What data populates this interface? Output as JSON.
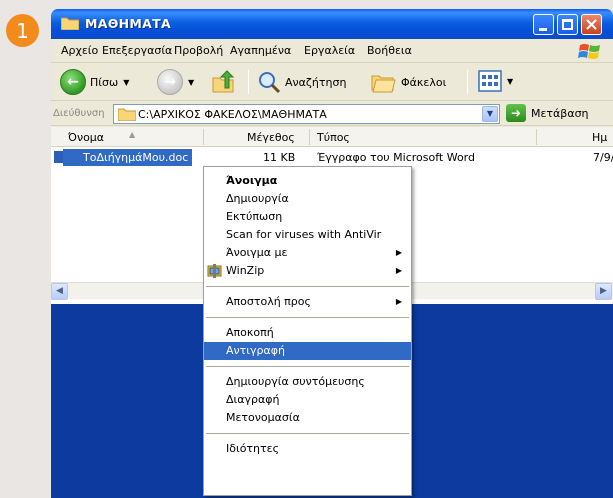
{
  "step_number": "1",
  "window": {
    "title": "ΜΑΘΗΜΑΤΑ",
    "controls": {
      "minimize": "minimize",
      "maximize": "maximize",
      "close": "close"
    }
  },
  "menu": [
    "Αρχείο",
    "Επεξεργασία",
    "Προβολή",
    "Αγαπημένα",
    "Εργαλεία",
    "Βοήθεια"
  ],
  "toolbar": {
    "back_label": "Πίσω",
    "search_label": "Αναζήτηση",
    "folders_label": "Φάκελοι"
  },
  "address": {
    "label": "Διεύθυνση",
    "value": "C:\\ΑΡΧΙΚΟΣ ΦΑΚΕΛΟΣ\\ΜΑΘΗΜΑΤΑ",
    "go_label": "Μετάβαση"
  },
  "columns": {
    "name": "Όνομα",
    "size": "Μέγεθος",
    "type": "Τύπος",
    "date": "Ημ"
  },
  "file": {
    "name": "ΤοΔιήγημάΜου.doc",
    "size": "11 KB",
    "type": "Έγγραφο του Microsoft Word",
    "date": "7/9/"
  },
  "context_menu": {
    "open": "Άνοιγμα",
    "new": "Δημιουργία",
    "print": "Εκτύπωση",
    "scan": "Scan for viruses with AntiVir",
    "open_with": "Άνοιγμα με",
    "winzip": "WinZip",
    "send_to": "Αποστολή προς",
    "cut": "Αποκοπή",
    "copy": "Αντιγραφή",
    "shortcut": "Δημιουργία συντόμευσης",
    "delete": "Διαγραφή",
    "rename": "Μετονομασία",
    "properties": "Ιδιότητες"
  },
  "colors": {
    "title_blue": "#0b5fe0",
    "selection_blue": "#316ac5",
    "desktop_blue": "#0c3a9e",
    "step_orange": "#f28a1c"
  }
}
